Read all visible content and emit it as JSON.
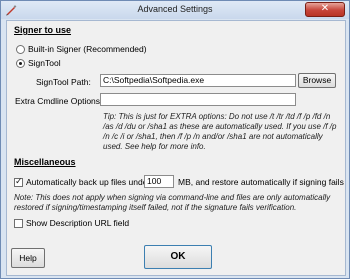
{
  "window": {
    "title": "Advanced Settings",
    "close_glyph": "✕"
  },
  "signer": {
    "heading": "Signer to use",
    "option_builtin": "Built-in Signer (Recommended)",
    "option_signtool": "SignTool",
    "selected": "SignTool",
    "path_label": "SignTool Path:",
    "path_value": "C:\\Softpedia\\Softpedia.exe",
    "browse_label": "Browse",
    "extra_label": "Extra Cmdline Options:",
    "extra_value": "",
    "tip": "Tip: This is just for EXTRA options: Do not use /t /tr /td /f /p /fd /n /as /d /du or /sha1 as these are automatically used. If you use /f /p /n /c /i or /sha1, then /f /p /n and/or /sha1 are not automatically used. See help for more info."
  },
  "misc": {
    "heading": "Miscellaneous",
    "auto_backup_label_pre": "Automatically back up files under",
    "auto_backup_value": "100",
    "auto_backup_label_post": "MB, and restore automatically if signing fails",
    "auto_backup_checked": true,
    "note": "Note: This does not apply when signing via command-line and files are only automatically restored if signing/timestamping itself failed, not if the signature fails verification.",
    "show_desc_label": "Show Description URL field",
    "show_desc_checked": false
  },
  "footer": {
    "help_label": "Help",
    "ok_label": "OK"
  }
}
